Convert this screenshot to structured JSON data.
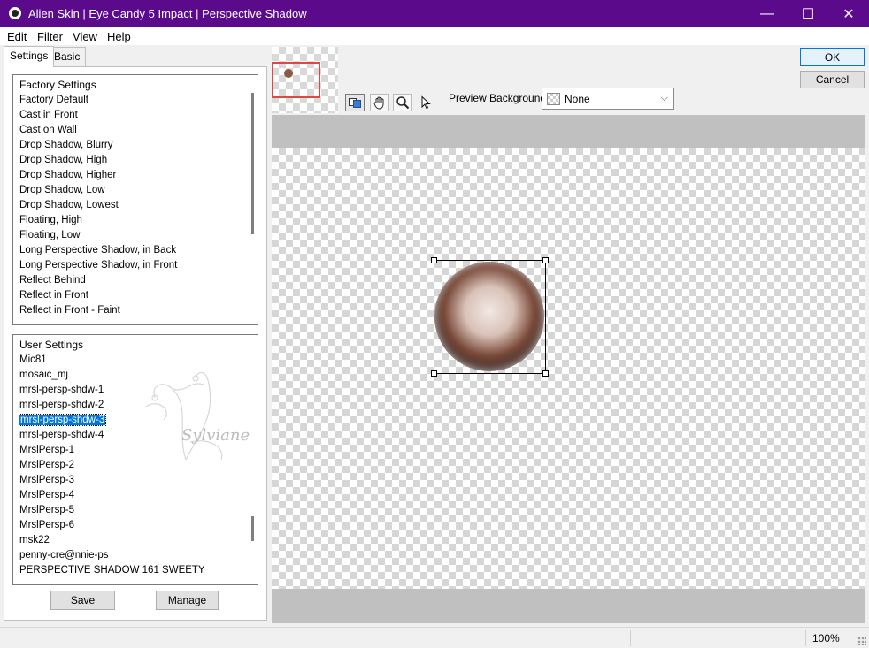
{
  "window": {
    "title": "Alien Skin | Eye Candy 5 Impact | Perspective Shadow",
    "controls": {
      "minimize": "—",
      "maximize": "☐",
      "close": "✕"
    },
    "accent_color": "#5b0a8c"
  },
  "menu": [
    {
      "key": "E",
      "rest": "dit"
    },
    {
      "key": "F",
      "rest": "ilter"
    },
    {
      "key": "V",
      "rest": "iew"
    },
    {
      "key": "H",
      "rest": "elp"
    }
  ],
  "tabs": {
    "settings": "Settings",
    "basic": "Basic",
    "active": "Settings"
  },
  "factory_list": {
    "header": "Factory Settings",
    "items": [
      "Factory Default",
      "Cast in Front",
      "Cast on Wall",
      "Drop Shadow, Blurry",
      "Drop Shadow, High",
      "Drop Shadow, Higher",
      "Drop Shadow, Low",
      "Drop Shadow, Lowest",
      "Floating, High",
      "Floating, Low",
      "Long Perspective Shadow, in Back",
      "Long Perspective Shadow, in Front",
      "Reflect Behind",
      "Reflect in Front",
      "Reflect in Front - Faint"
    ]
  },
  "user_list": {
    "header": "User Settings",
    "items": [
      "Mic81",
      "mosaic_mj",
      "mrsl-persp-shdw-1",
      "mrsl-persp-shdw-2",
      "mrsl-persp-shdw-3",
      "mrsl-persp-shdw-4",
      "MrslPersp-1",
      "MrslPersp-2",
      "MrslPersp-3",
      "MrslPersp-4",
      "MrslPersp-5",
      "MrslPersp-6",
      "msk22",
      "penny-cre@nnie-ps",
      "PERSPECTIVE SHADOW 161 SWEETY"
    ],
    "selected": "mrsl-persp-shdw-3"
  },
  "watermark": "Sylviane",
  "buttons": {
    "save": "Save",
    "manage": "Manage",
    "ok": "OK",
    "cancel": "Cancel"
  },
  "toolbar": {
    "tools": [
      "preview-toggle-icon",
      "hand-icon",
      "zoom-icon",
      "pointer-icon"
    ],
    "preview_background_label": "Preview Background:",
    "preview_background_value": "None"
  },
  "status": {
    "zoom": "100%"
  },
  "colors": {
    "selection": "#0078d7",
    "thumb_frame": "#e04646",
    "preview_gray": "#c0c0c0"
  }
}
